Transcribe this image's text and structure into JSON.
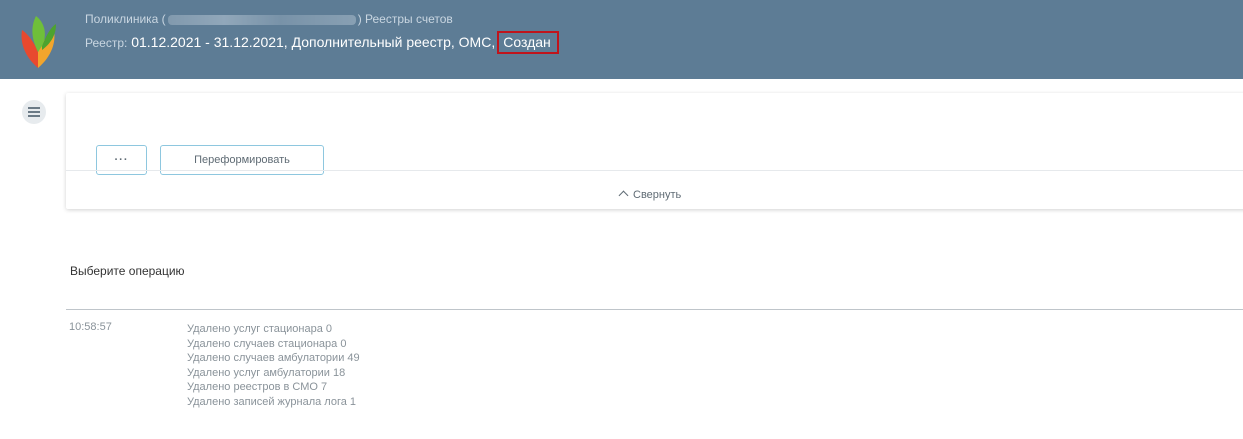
{
  "header": {
    "line1_left": "Поликлиника (",
    "line1_right": ") Реестры счетов",
    "registry_label": "Реестр:",
    "registry_value": "01.12.2021 - 31.12.2021, Дополнительный реестр, ОМС,",
    "status": "Создан"
  },
  "toolbar": {
    "more_label": "···",
    "reform_label": "Переформировать",
    "collapse_label": "Свернуть"
  },
  "operations": {
    "title": "Выберите операцию",
    "log": {
      "time": "10:58:57",
      "lines": [
        "Удалено услуг стационара 0",
        "Удалено случаев стационара 0",
        "Удалено случаев амбулатории 49",
        "Удалено услуг амбулатории 18",
        "Удалено реестров в СМО 7",
        "Удалено записей журнала лога 1"
      ]
    }
  },
  "colors": {
    "header_bg": "#5d7c95",
    "status_border": "#c0141b",
    "button_border": "#8ec7df"
  }
}
